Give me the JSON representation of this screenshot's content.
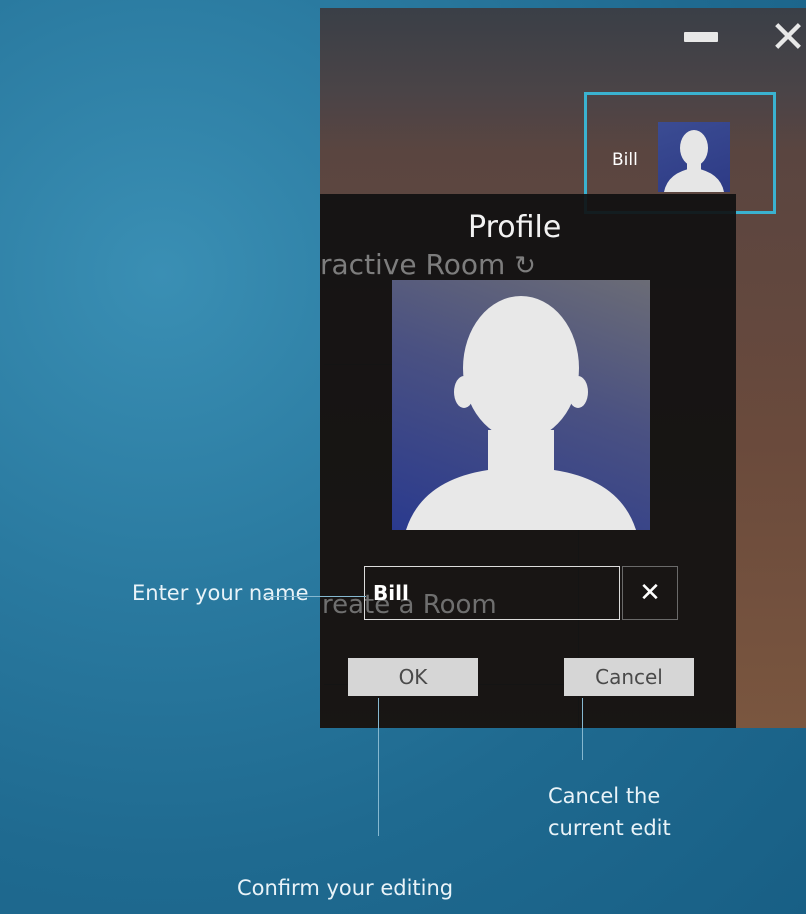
{
  "window": {
    "background_room_title": "ractive Room",
    "background_create_room": "reate a Room"
  },
  "user_badge": {
    "name": "Bill"
  },
  "profile": {
    "title": "Profile",
    "name_value": "Bill",
    "ok_label": "OK",
    "cancel_label": "Cancel"
  },
  "annotations": {
    "name_hint": "Enter your name",
    "cancel_hint_line1": "Cancel the",
    "cancel_hint_line2": "current edit",
    "confirm_hint": "Confirm your editing"
  },
  "icons": {
    "minimize": "minimize-icon",
    "close": "close-icon",
    "clear": "clear-x-icon",
    "refresh": "refresh-icon",
    "avatar": "person-silhouette-icon"
  },
  "colors": {
    "highlight": "#3ab2d0",
    "button_bg": "#d6d6d6",
    "avatar_blue": "#2d3a85"
  }
}
